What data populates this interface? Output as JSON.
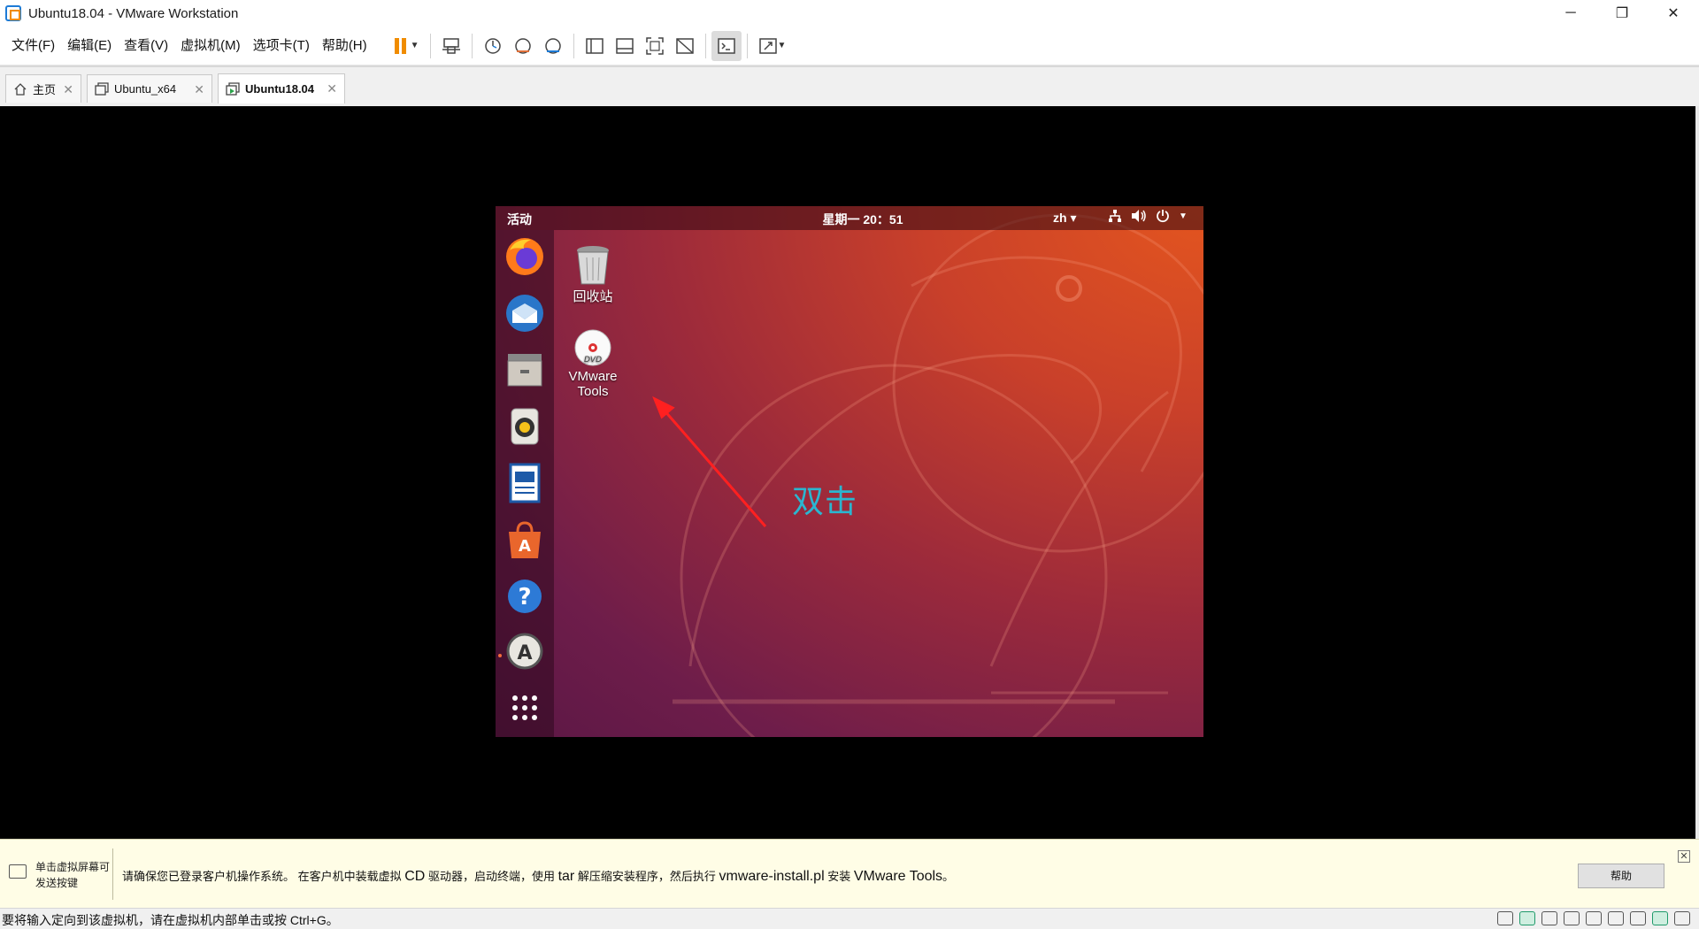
{
  "window": {
    "title": "Ubuntu18.04 - VMware Workstation",
    "min": "─",
    "restore": "❐",
    "close": "✕"
  },
  "menu": {
    "items": [
      "文件(F)",
      "编辑(E)",
      "查看(V)",
      "虚拟机(M)",
      "选项卡(T)",
      "帮助(H)"
    ]
  },
  "toolbar": {
    "icons": [
      "pause-icon",
      "send-ctrl-alt-del-icon",
      "snapshot-icon",
      "revert-snapshot-icon",
      "manage-snapshots-icon",
      "library-view-icon",
      "thumbnail-view-icon",
      "fullscreen-icon",
      "unity-icon",
      "console-view-icon",
      "stretch-guest-icon"
    ],
    "accent": "#f08c00"
  },
  "tabs": [
    {
      "label": "主页",
      "icon": "home-icon"
    },
    {
      "label": "Ubuntu_x64",
      "icon": "vm-icon"
    },
    {
      "label": "Ubuntu18.04",
      "icon": "vm-running-icon",
      "active": true
    }
  ],
  "ubuntu": {
    "activities": "活动",
    "clock": "星期一 20：51",
    "lang": "zh ▾",
    "desktop_icons": [
      {
        "label": "回收站",
        "icon": "trash-icon"
      },
      {
        "label_line1": "VMware",
        "label_line2": "Tools",
        "icon": "dvd-icon"
      }
    ],
    "dock": [
      "firefox-icon",
      "thunderbird-icon",
      "files-icon",
      "rhythmbox-icon",
      "writer-icon",
      "software-center-icon",
      "help-icon",
      "software-updater-icon",
      "show-apps-icon"
    ]
  },
  "annotation": {
    "text": "双击",
    "color": "#2bb6d0",
    "arrow_color": "#ff2020"
  },
  "hint": {
    "left_line1": "单击虚拟屏幕可",
    "left_line2": "发送按键",
    "part1": "请确保您已登录客户机操作系统。 在客户机中装载虚拟 ",
    "cd": "CD",
    "part2": " 驱动器，启动终端，使用 ",
    "tar": "tar",
    "part3": " 解压缩安装程序，然后执行 ",
    "script": "vmware-install.pl",
    "part4": " 安装 ",
    "tools": "VMware Tools",
    "part5": "。",
    "help_button": "帮助",
    "close": "✕"
  },
  "status": {
    "text": "要将输入定向到该虚拟机，请在虚拟机内部单击或按 Ctrl+G。"
  }
}
